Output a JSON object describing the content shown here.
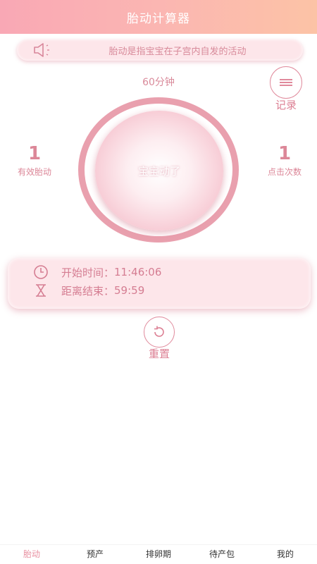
{
  "header": {
    "title": "胎动计算器"
  },
  "notice": {
    "text": "胎动是指宝宝在子宫内自发的活动"
  },
  "session": {
    "duration": "60分钟"
  },
  "record": {
    "label": "记录"
  },
  "stats": {
    "effective": {
      "value": "1",
      "label": "有效胎动"
    },
    "clicks": {
      "value": "1",
      "label": "点击次数"
    }
  },
  "main_button": {
    "label": "宝宝动了"
  },
  "timer": {
    "start_label": "开始时间：",
    "start_value": "11:46:06",
    "remain_label": "距离结束：",
    "remain_value": "59:59"
  },
  "reset": {
    "label": "重置"
  },
  "tabs": [
    {
      "label": "胎动",
      "active": true
    },
    {
      "label": "预产"
    },
    {
      "label": "排卵期"
    },
    {
      "label": "待产包"
    },
    {
      "label": "我的"
    }
  ],
  "colors": {
    "accent": "#e08a9c",
    "header_start": "#f9a8b5",
    "header_end": "#fcc3a6",
    "card_bg": "#fde6ea"
  }
}
